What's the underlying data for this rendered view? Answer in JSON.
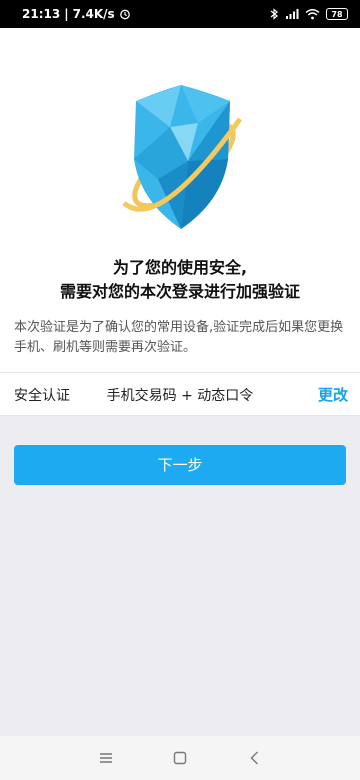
{
  "status_bar": {
    "time": "21:13",
    "speed": "7.4K/s",
    "battery": "78"
  },
  "headline": {
    "line1": "为了您的使用安全,",
    "line2": "需要对您的本次登录进行加强验证"
  },
  "description": "本次验证是为了确认您的常用设备,验证完成后如果您更换手机、刷机等则需要再次验证。",
  "auth_row": {
    "label": "安全认证",
    "value": "手机交易码 + 动态口令",
    "change": "更改"
  },
  "next_button": "下一步",
  "colors": {
    "accent": "#1eaaf1",
    "shield": "#3bb6ea",
    "ring": "#f0c04a"
  }
}
